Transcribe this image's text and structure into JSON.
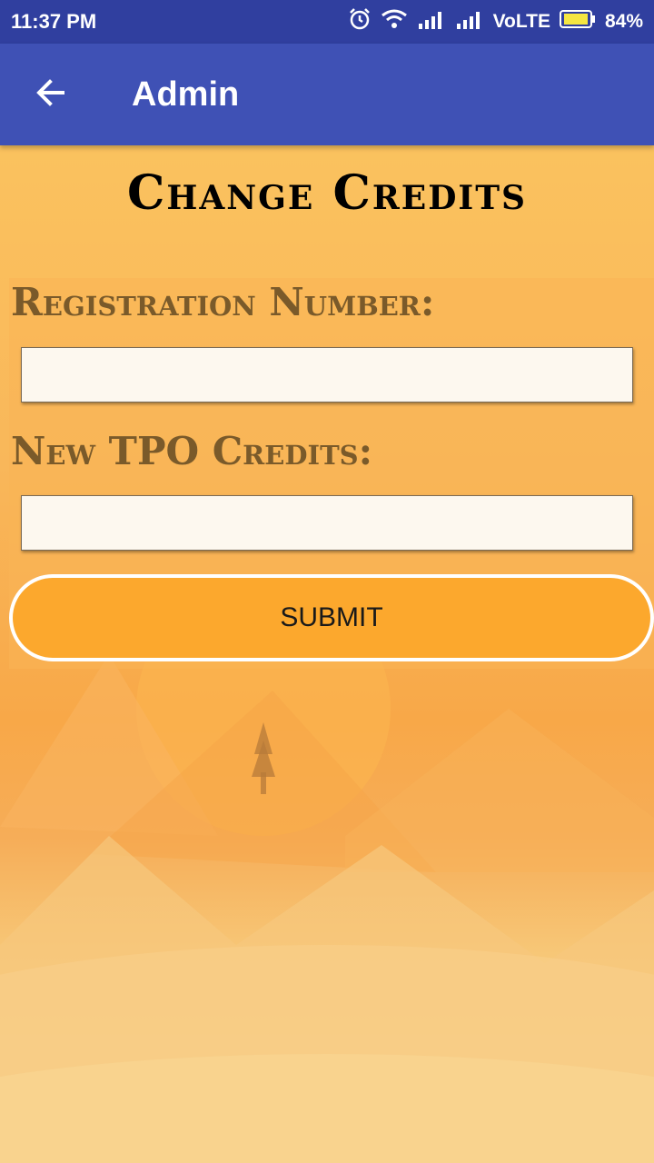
{
  "status_bar": {
    "time": "11:37 PM",
    "network": "VoLTE",
    "battery": "84%",
    "icons": [
      "alarm-icon",
      "wifi-icon",
      "signal-icon",
      "signal-icon",
      "battery-icon"
    ],
    "color": "#303f9f"
  },
  "app_bar": {
    "title": "Admin",
    "back_icon": "arrow-back-icon",
    "color": "#3f51b5"
  },
  "page": {
    "title": "Change Credits"
  },
  "form": {
    "registration_label": "Registration Number:",
    "registration_value": "",
    "credits_label": "New TPO Credits:",
    "credits_value": "",
    "submit_label": "SUBMIT",
    "submit_color": "#fca82d"
  }
}
